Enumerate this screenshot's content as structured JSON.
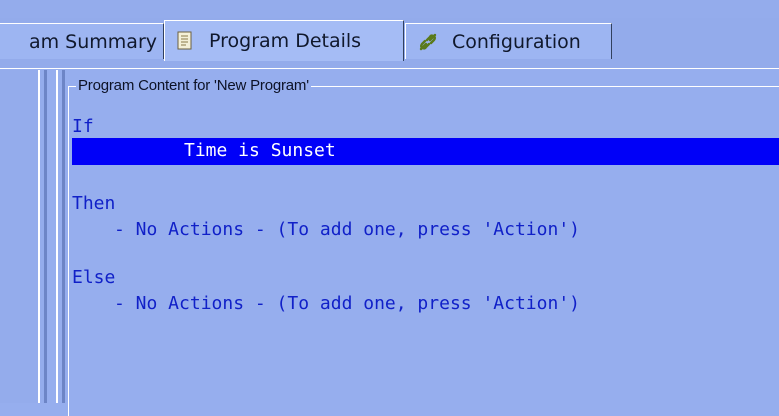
{
  "tabs": {
    "summary_label": "am Summary",
    "details_label": "Program Details",
    "config_label": "Configuration",
    "details_icon": "document-icon",
    "config_icon": "link-icon"
  },
  "program": {
    "group_title": "Program Content for 'New Program'",
    "if_keyword": "If",
    "condition": "Time is Sunset",
    "then_keyword": "Then",
    "then_action": "- No Actions - (To add one, press 'Action')",
    "else_keyword": "Else",
    "else_action": "- No Actions - (To add one, press 'Action')"
  },
  "colors": {
    "background": "#96aeee",
    "selection": "#0000f8",
    "code_text": "#1020c8"
  }
}
